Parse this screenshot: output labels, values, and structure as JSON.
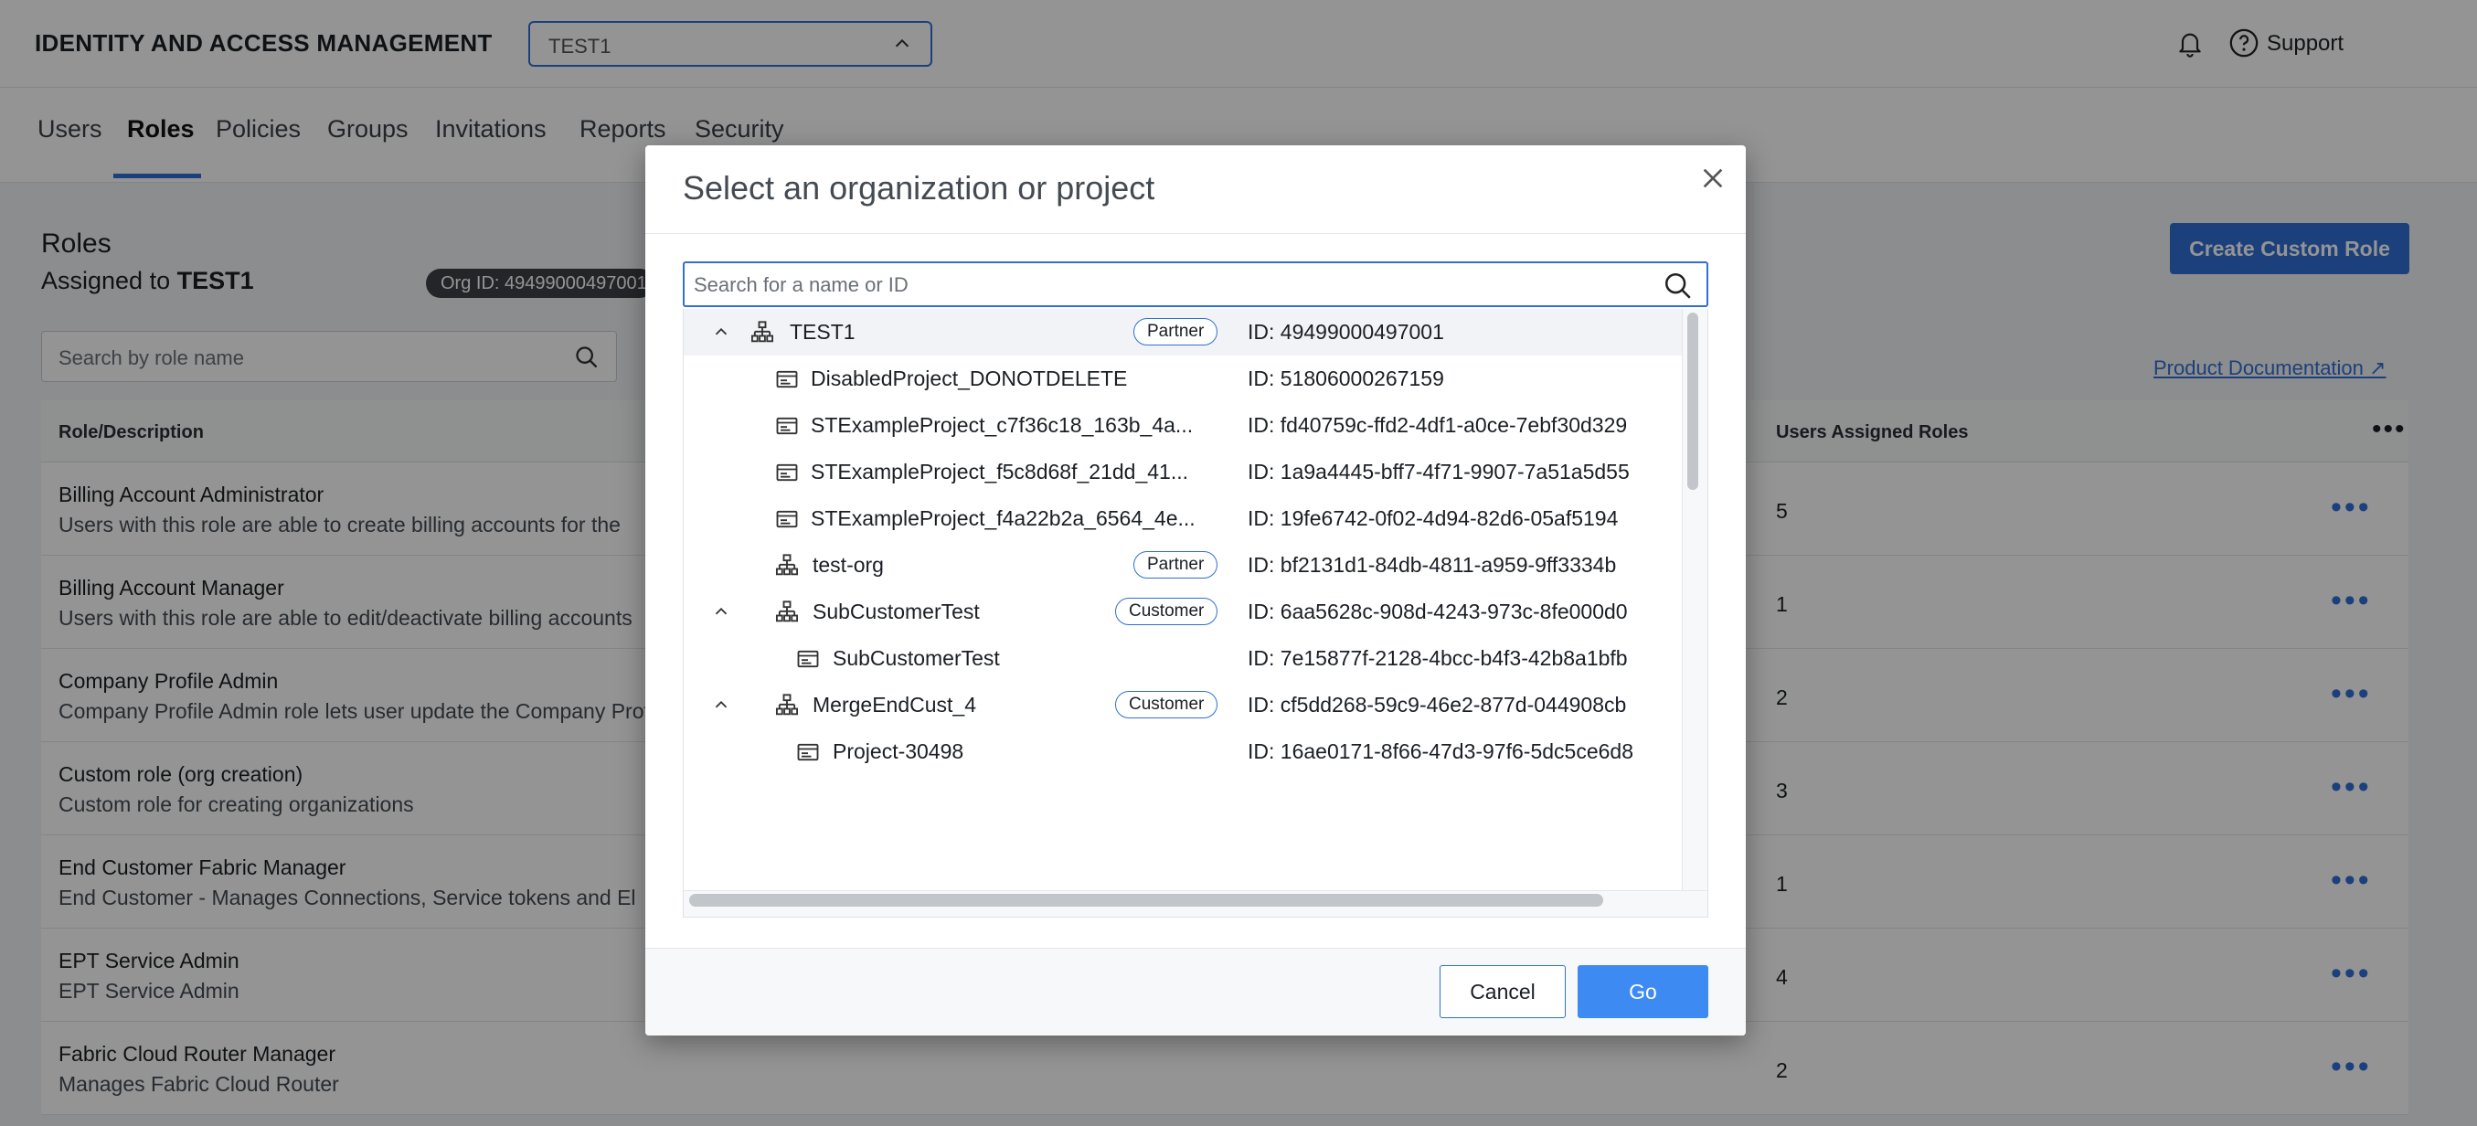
{
  "header": {
    "app_title": "IDENTITY AND ACCESS MANAGEMENT",
    "org_selector_value": "TEST1",
    "support_label": "Support"
  },
  "tabs": [
    {
      "label": "Users"
    },
    {
      "label": "Roles"
    },
    {
      "label": "Policies"
    },
    {
      "label": "Groups"
    },
    {
      "label": "Invitations"
    },
    {
      "label": "Reports"
    },
    {
      "label": "Security"
    }
  ],
  "roles_page": {
    "title": "Roles",
    "assigned_prefix": "Assigned to",
    "assigned_org": "TEST1",
    "org_id_pill": "Org ID: 49499000497001",
    "create_button": "Create Custom Role",
    "search_placeholder": "Search by role name",
    "product_doc_link": "Product Documentation",
    "col_role": "Role/Description",
    "col_users": "Users Assigned Roles",
    "rows": [
      {
        "name": "Billing Account Administrator",
        "desc": "Users with this role are able to create billing accounts for the",
        "count": "5"
      },
      {
        "name": "Billing Account Manager",
        "desc": "Users with this role are able to edit/deactivate billing accounts",
        "count": "1"
      },
      {
        "name": "Company Profile Admin",
        "desc": "Company Profile Admin role lets user update the Company Profile",
        "count": "2"
      },
      {
        "name": "Custom role (org creation)",
        "desc": "Custom role for creating organizations",
        "count": "3"
      },
      {
        "name": "End Customer Fabric Manager",
        "desc": "End Customer - Manages Connections, Service tokens and El",
        "count": "1"
      },
      {
        "name": "EPT Service Admin",
        "desc": "EPT Service Admin",
        "count": "4"
      },
      {
        "name": "Fabric Cloud Router Manager",
        "desc": "Manages Fabric Cloud Router",
        "count": "2"
      }
    ]
  },
  "modal": {
    "title": "Select an organization or project",
    "search_placeholder": "Search for a name or ID",
    "cancel_label": "Cancel",
    "go_label": "Go",
    "tree": [
      {
        "name": "TEST1",
        "type": "org",
        "level": 0,
        "expandable": true,
        "badge": "Partner",
        "id": "ID: 49499000497001"
      },
      {
        "name": "DisabledProject_DONOTDELETE",
        "type": "project",
        "level": 1,
        "expandable": false,
        "badge": "",
        "id": "ID: 51806000267159"
      },
      {
        "name": "STExampleProject_c7f36c18_163b_4a...",
        "type": "project",
        "level": 1,
        "expandable": false,
        "badge": "",
        "id": "ID: fd40759c-ffd2-4df1-a0ce-7ebf30d329"
      },
      {
        "name": "STExampleProject_f5c8d68f_21dd_41...",
        "type": "project",
        "level": 1,
        "expandable": false,
        "badge": "",
        "id": "ID: 1a9a4445-bff7-4f71-9907-7a51a5d55"
      },
      {
        "name": "STExampleProject_f4a22b2a_6564_4e...",
        "type": "project",
        "level": 1,
        "expandable": false,
        "badge": "",
        "id": "ID: 19fe6742-0f02-4d94-82d6-05af5194"
      },
      {
        "name": "test-org",
        "type": "org",
        "level": 1,
        "expandable": false,
        "badge": "Partner",
        "id": "ID: bf2131d1-84db-4811-a959-9ff3334b"
      },
      {
        "name": "SubCustomerTest",
        "type": "org",
        "level": 1,
        "expandable": true,
        "badge": "Customer",
        "id": "ID: 6aa5628c-908d-4243-973c-8fe000d0"
      },
      {
        "name": "SubCustomerTest",
        "type": "project",
        "level": 2,
        "expandable": false,
        "badge": "",
        "id": "ID: 7e15877f-2128-4bcc-b4f3-42b8a1bfb"
      },
      {
        "name": "MergeEndCust_4",
        "type": "org",
        "level": 1,
        "expandable": true,
        "badge": "Customer",
        "id": "ID: cf5dd268-59c9-46e2-877d-044908cb"
      },
      {
        "name": "Project-30498",
        "type": "project",
        "level": 2,
        "expandable": false,
        "badge": "",
        "id": "ID: 16ae0171-8f66-47d3-97f6-5dc5ce6d8"
      }
    ]
  },
  "colors": {
    "accent": "#2f6fd6",
    "go_button": "#3d8bf2",
    "overlay": "rgba(0,0,0,0.42)"
  }
}
